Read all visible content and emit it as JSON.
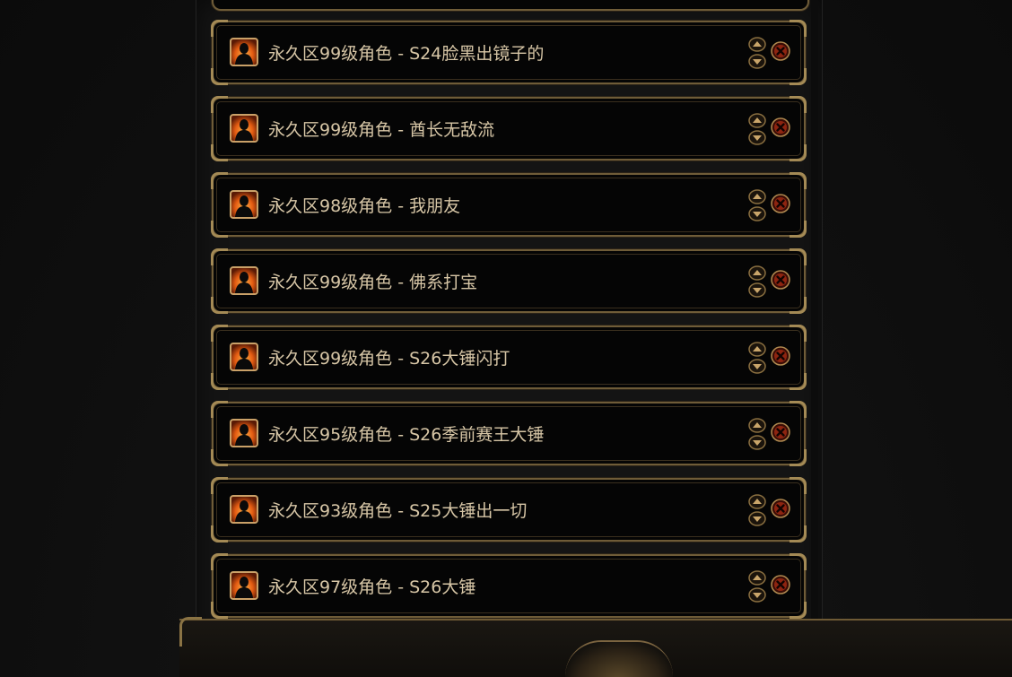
{
  "characters": [
    {
      "label": "永久区99级角色 - S24脸黑出镜子的"
    },
    {
      "label": "永久区99级角色 - 酋长无敌流"
    },
    {
      "label": "永久区98级角色 - 我朋友"
    },
    {
      "label": "永久区99级角色 - 佛系打宝"
    },
    {
      "label": "永久区99级角色 - S26大锤闪打"
    },
    {
      "label": "永久区95级角色 - S26季前赛王大锤"
    },
    {
      "label": "永久区93级角色 - S25大锤出一切"
    },
    {
      "label": "永久区97级角色 - S26大锤"
    }
  ],
  "icons": {
    "avatar": "character-portrait-icon",
    "move_up": "arrow-up-icon",
    "move_down": "arrow-down-icon",
    "remove": "close-circle-icon"
  },
  "colors": {
    "gold": "#a48a55",
    "label": "#d7c6a6",
    "remove_red": "#c4351a"
  }
}
